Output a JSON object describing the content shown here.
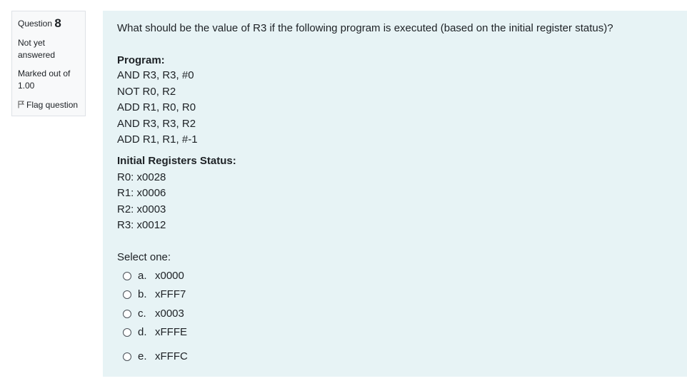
{
  "question_info": {
    "label": "Question",
    "number": "8",
    "state_line1": "Not yet",
    "state_line2": "answered",
    "grade_line1": "Marked out of",
    "grade_line2": "1.00",
    "flag_label": "Flag question",
    "flag_icon": "flag-icon"
  },
  "question": {
    "text": "What should be the value of R3 if the following program is executed (based on the initial register status)?",
    "program_heading": "Program:",
    "program": [
      "AND R3, R3, #0",
      "NOT R0, R2",
      "ADD R1, R0, R0",
      "AND R3, R3, R2",
      "ADD R1, R1, #-1"
    ],
    "registers_heading": "Initial Registers Status:",
    "registers": [
      "R0: x0028",
      "R1: x0006",
      "R2: x0003",
      "R3: x0012"
    ],
    "prompt": "Select one:",
    "options": [
      {
        "letter": "a.",
        "value": "x0000"
      },
      {
        "letter": "b.",
        "value": "xFFF7"
      },
      {
        "letter": "c.",
        "value": "x0003"
      },
      {
        "letter": "d.",
        "value": "xFFFE"
      },
      {
        "letter": "e.",
        "value": "xFFFC"
      }
    ]
  },
  "colors": {
    "content_background": "#e7f3f5",
    "info_background": "#f8f9fa",
    "text": "#1d2125"
  }
}
